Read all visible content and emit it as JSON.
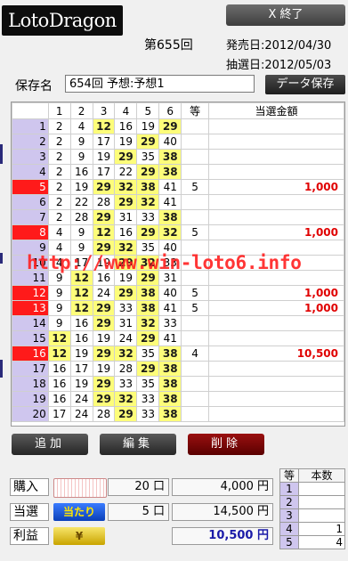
{
  "app": {
    "logo_text": "LotoDragon",
    "close_label": "X 終了"
  },
  "header": {
    "draw_no": "第655回",
    "sale_date": "発売日:2012/04/30",
    "draw_date": "抽選日:2012/05/03"
  },
  "save": {
    "label": "保存名",
    "value": "654回 予想:予想1",
    "button": "データ保存"
  },
  "grid": {
    "headers": [
      "",
      "1",
      "2",
      "3",
      "4",
      "5",
      "6",
      "等",
      "当選金額"
    ],
    "rows": [
      {
        "no": "1",
        "nums": [
          "2",
          "4",
          "12",
          "16",
          "19",
          "29"
        ],
        "hits": [
          false,
          false,
          true,
          false,
          false,
          true
        ],
        "grade": "",
        "prize": "",
        "win": false
      },
      {
        "no": "2",
        "nums": [
          "2",
          "9",
          "17",
          "19",
          "29",
          "40"
        ],
        "hits": [
          false,
          false,
          false,
          false,
          true,
          false
        ],
        "grade": "",
        "prize": "",
        "win": false
      },
      {
        "no": "3",
        "nums": [
          "2",
          "9",
          "19",
          "29",
          "35",
          "38"
        ],
        "hits": [
          false,
          false,
          false,
          true,
          false,
          true
        ],
        "grade": "",
        "prize": "",
        "win": false
      },
      {
        "no": "4",
        "nums": [
          "2",
          "16",
          "17",
          "22",
          "29",
          "38"
        ],
        "hits": [
          false,
          false,
          false,
          false,
          true,
          true
        ],
        "grade": "",
        "prize": "",
        "win": false
      },
      {
        "no": "5",
        "nums": [
          "2",
          "19",
          "29",
          "32",
          "38",
          "41"
        ],
        "hits": [
          false,
          false,
          true,
          true,
          true,
          false
        ],
        "grade": "5",
        "prize": "1,000",
        "win": true
      },
      {
        "no": "6",
        "nums": [
          "2",
          "22",
          "28",
          "29",
          "32",
          "41"
        ],
        "hits": [
          false,
          false,
          false,
          true,
          true,
          false
        ],
        "grade": "",
        "prize": "",
        "win": false
      },
      {
        "no": "7",
        "nums": [
          "2",
          "28",
          "29",
          "31",
          "33",
          "38"
        ],
        "hits": [
          false,
          false,
          true,
          false,
          false,
          true
        ],
        "grade": "",
        "prize": "",
        "win": false
      },
      {
        "no": "8",
        "nums": [
          "4",
          "9",
          "12",
          "16",
          "29",
          "32"
        ],
        "hits": [
          false,
          false,
          true,
          false,
          true,
          true
        ],
        "grade": "5",
        "prize": "1,000",
        "win": true
      },
      {
        "no": "9",
        "nums": [
          "4",
          "9",
          "29",
          "32",
          "35",
          "40"
        ],
        "hits": [
          false,
          false,
          true,
          true,
          false,
          false
        ],
        "grade": "",
        "prize": "",
        "win": false
      },
      {
        "no": "10",
        "nums": [
          "4",
          "17",
          "19",
          "29",
          "32",
          "33"
        ],
        "hits": [
          false,
          false,
          false,
          true,
          true,
          false
        ],
        "grade": "",
        "prize": "",
        "win": false
      },
      {
        "no": "11",
        "nums": [
          "9",
          "12",
          "16",
          "19",
          "29",
          "31"
        ],
        "hits": [
          false,
          true,
          false,
          false,
          true,
          false
        ],
        "grade": "",
        "prize": "",
        "win": false
      },
      {
        "no": "12",
        "nums": [
          "9",
          "12",
          "24",
          "29",
          "38",
          "40"
        ],
        "hits": [
          false,
          true,
          false,
          true,
          true,
          false
        ],
        "grade": "5",
        "prize": "1,000",
        "win": true
      },
      {
        "no": "13",
        "nums": [
          "9",
          "12",
          "29",
          "33",
          "38",
          "41"
        ],
        "hits": [
          false,
          true,
          true,
          false,
          true,
          false
        ],
        "grade": "5",
        "prize": "1,000",
        "win": true
      },
      {
        "no": "14",
        "nums": [
          "9",
          "16",
          "29",
          "31",
          "32",
          "33"
        ],
        "hits": [
          false,
          false,
          true,
          false,
          true,
          false
        ],
        "grade": "",
        "prize": "",
        "win": false
      },
      {
        "no": "15",
        "nums": [
          "12",
          "16",
          "19",
          "24",
          "29",
          "41"
        ],
        "hits": [
          true,
          false,
          false,
          false,
          true,
          false
        ],
        "grade": "",
        "prize": "",
        "win": false
      },
      {
        "no": "16",
        "nums": [
          "12",
          "19",
          "29",
          "32",
          "35",
          "38"
        ],
        "hits": [
          true,
          false,
          true,
          true,
          false,
          true
        ],
        "grade": "4",
        "prize": "10,500",
        "win": true
      },
      {
        "no": "17",
        "nums": [
          "16",
          "17",
          "19",
          "28",
          "29",
          "38"
        ],
        "hits": [
          false,
          false,
          false,
          false,
          true,
          true
        ],
        "grade": "",
        "prize": "",
        "win": false
      },
      {
        "no": "18",
        "nums": [
          "16",
          "19",
          "29",
          "33",
          "35",
          "38"
        ],
        "hits": [
          false,
          false,
          true,
          false,
          false,
          true
        ],
        "grade": "",
        "prize": "",
        "win": false
      },
      {
        "no": "19",
        "nums": [
          "16",
          "24",
          "29",
          "32",
          "33",
          "38"
        ],
        "hits": [
          false,
          false,
          true,
          true,
          false,
          true
        ],
        "grade": "",
        "prize": "",
        "win": false
      },
      {
        "no": "20",
        "nums": [
          "17",
          "24",
          "28",
          "29",
          "33",
          "38"
        ],
        "hits": [
          false,
          false,
          false,
          true,
          false,
          true
        ],
        "grade": "",
        "prize": "",
        "win": false
      }
    ]
  },
  "watermark": "http://www.win-loto6.info",
  "actions": {
    "add": "追加",
    "edit": "編集",
    "delete": "削除"
  },
  "summary": {
    "purchase": {
      "label": "購入",
      "count": "20 口",
      "amount": "4,000 円"
    },
    "win": {
      "label": "当選",
      "icon_text": "当たり",
      "count": "5 口",
      "amount": "14,500 円"
    },
    "profit": {
      "label": "利益",
      "icon_text": "¥",
      "amount": "10,500 円"
    }
  },
  "grade_table": {
    "headers": [
      "等",
      "本数"
    ],
    "rows": [
      {
        "grade": "1",
        "count": ""
      },
      {
        "grade": "2",
        "count": ""
      },
      {
        "grade": "3",
        "count": ""
      },
      {
        "grade": "4",
        "count": "1"
      },
      {
        "grade": "5",
        "count": "4"
      }
    ]
  },
  "colors": {
    "hit": "#fdfd7a",
    "win_row": "#ff1a1a",
    "row_no": "#cfc6ee",
    "prize": "#e00000",
    "profit": "#1a1aa8"
  }
}
